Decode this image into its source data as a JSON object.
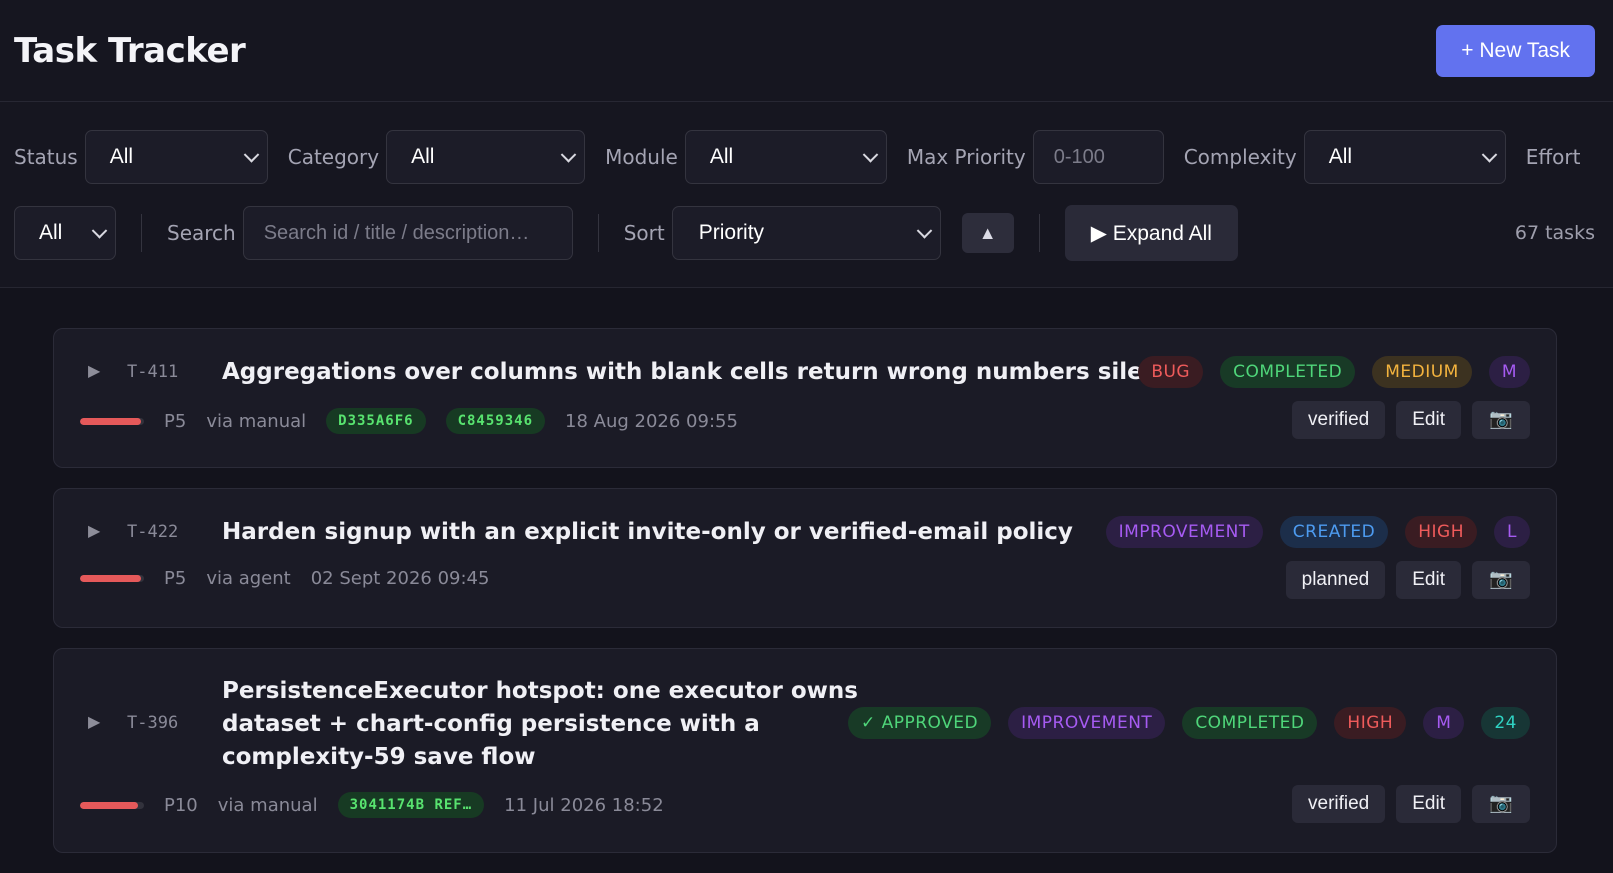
{
  "app": {
    "title": "Task Tracker",
    "new_task_label": "+ New Task"
  },
  "filters": {
    "status": {
      "label": "Status",
      "value": "All"
    },
    "category": {
      "label": "Category",
      "value": "All"
    },
    "module": {
      "label": "Module",
      "value": "All"
    },
    "max_priority": {
      "label": "Max Priority",
      "placeholder": "0-100"
    },
    "complexity": {
      "label": "Complexity",
      "value": "All"
    },
    "effort": {
      "label": "Effort",
      "value": "All"
    },
    "search": {
      "label": "Search",
      "placeholder": "Search id / title / description…"
    },
    "sort": {
      "label": "Sort",
      "value": "Priority",
      "direction_glyph": "▲"
    },
    "expand_all_label": "▶ Expand All",
    "count_text": "67 tasks"
  },
  "tasks": [
    {
      "caret": "▶",
      "id": "T-411",
      "title": "Aggregations over columns with blank cells return wrong numbers silently",
      "tags": [
        "BUG",
        "COMPLETED",
        "MEDIUM",
        "M"
      ],
      "priority_label": "P5",
      "priority_fill": 0.95,
      "source": "via manual",
      "hashes": [
        "D335A6F6",
        "C8459346"
      ],
      "timestamp": "18 Aug 2026 09:55",
      "state_button": "verified",
      "edit_label": "Edit",
      "camera_icon": "📷"
    },
    {
      "caret": "▶",
      "id": "T-422",
      "title": "Harden signup with an explicit invite-only or verified-email policy",
      "tags": [
        "IMPROVEMENT",
        "CREATED",
        "HIGH",
        "L"
      ],
      "priority_label": "P5",
      "priority_fill": 0.95,
      "source": "via agent",
      "hashes": [],
      "timestamp": "02 Sept 2026 09:45",
      "state_button": "planned",
      "edit_label": "Edit",
      "camera_icon": "📷"
    },
    {
      "caret": "▶",
      "id": "T-396",
      "title_lines": [
        "PersistenceExecutor hotspot: one executor owns",
        "dataset + chart-config persistence with a",
        "complexity-59 save flow"
      ],
      "tags": [
        "✓ APPROVED",
        "IMPROVEMENT",
        "COMPLETED",
        "HIGH",
        "M",
        "24"
      ],
      "priority_label": "P10",
      "priority_fill": 0.9,
      "source": "via manual",
      "hashes": [
        "3041174B REF…"
      ],
      "timestamp": "11 Jul 2026 18:52",
      "state_button": "verified",
      "edit_label": "Edit",
      "camera_icon": "📷"
    }
  ],
  "colors": {
    "accent": "#6272ef",
    "tag_bug": "#ef5b5b",
    "tag_completed": "#4fd67a",
    "tag_medium": "#f3b33e",
    "tag_high": "#ef5b5b",
    "tag_improvement": "#a65bf2",
    "tag_created": "#4d9bf0",
    "tag_size": "#a65bf2",
    "tag_count": "#2fd3c3",
    "priority_bar": "#e5595a"
  }
}
